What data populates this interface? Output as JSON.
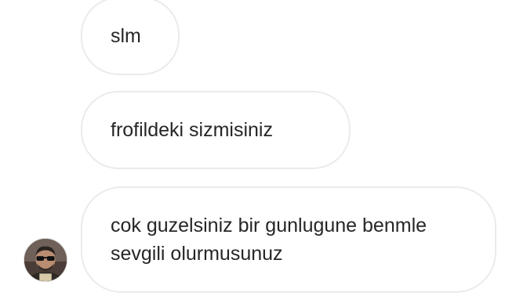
{
  "thread": {
    "messages": [
      {
        "text": "slm"
      },
      {
        "text": "frofildeki sizmisiniz"
      },
      {
        "text": "cok guzelsiniz bir gunlugune benmle sevgili olurmusunuz"
      }
    ]
  },
  "sender": {
    "avatar_icon": "user-avatar-photo"
  },
  "colors": {
    "background": "#ffffff",
    "bubble_border": "#ebebeb",
    "text": "#262626"
  }
}
